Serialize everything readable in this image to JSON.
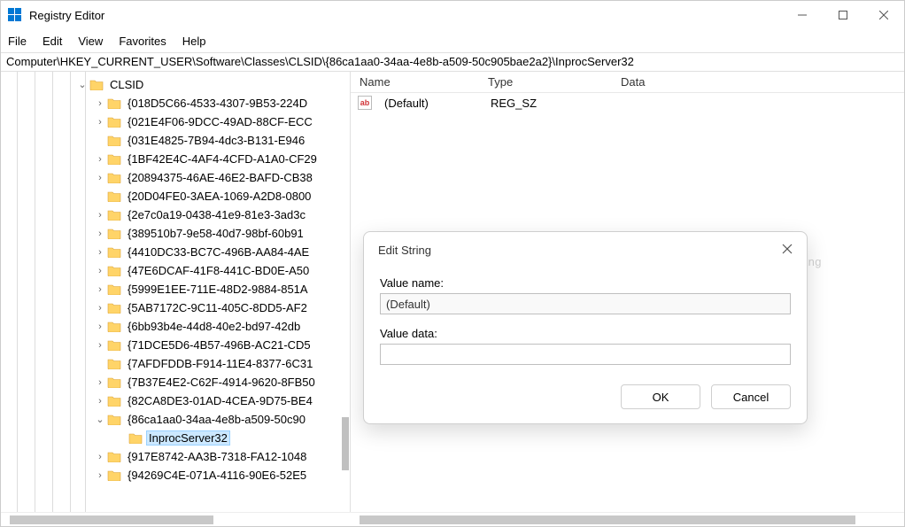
{
  "titlebar": {
    "title": "Registry Editor"
  },
  "menu": {
    "file": "File",
    "edit": "Edit",
    "view": "View",
    "favorites": "Favorites",
    "help": "Help"
  },
  "address": "Computer\\HKEY_CURRENT_USER\\Software\\Classes\\CLSID\\{86ca1aa0-34aa-4e8b-a509-50c905bae2a2}\\InprocServer32",
  "tree": {
    "parent": {
      "label": "CLSID",
      "expander": "⌄"
    },
    "items": [
      {
        "expander": "›",
        "label": "{018D5C66-4533-4307-9B53-224D"
      },
      {
        "expander": "›",
        "label": "{021E4F06-9DCC-49AD-88CF-ECC"
      },
      {
        "expander": "",
        "label": "{031E4825-7B94-4dc3-B131-E946"
      },
      {
        "expander": "›",
        "label": "{1BF42E4C-4AF4-4CFD-A1A0-CF29"
      },
      {
        "expander": "›",
        "label": "{20894375-46AE-46E2-BAFD-CB38"
      },
      {
        "expander": "",
        "label": "{20D04FE0-3AEA-1069-A2D8-0800"
      },
      {
        "expander": "›",
        "label": "{2e7c0a19-0438-41e9-81e3-3ad3c"
      },
      {
        "expander": "›",
        "label": "{389510b7-9e58-40d7-98bf-60b91"
      },
      {
        "expander": "›",
        "label": "{4410DC33-BC7C-496B-AA84-4AE"
      },
      {
        "expander": "›",
        "label": "{47E6DCAF-41F8-441C-BD0E-A50"
      },
      {
        "expander": "›",
        "label": "{5999E1EE-711E-48D2-9884-851A"
      },
      {
        "expander": "›",
        "label": "{5AB7172C-9C11-405C-8DD5-AF2"
      },
      {
        "expander": "›",
        "label": "{6bb93b4e-44d8-40e2-bd97-42db"
      },
      {
        "expander": "›",
        "label": "{71DCE5D6-4B57-496B-AC21-CD5"
      },
      {
        "expander": "",
        "label": "{7AFDFDDB-F914-11E4-8377-6C31"
      },
      {
        "expander": "›",
        "label": "{7B37E4E2-C62F-4914-9620-8FB50"
      },
      {
        "expander": "›",
        "label": "{82CA8DE3-01AD-4CEA-9D75-BE4"
      },
      {
        "expander": "⌄",
        "label": "{86ca1aa0-34aa-4e8b-a509-50c90"
      }
    ],
    "selected": {
      "label": "InprocServer32"
    },
    "after": [
      {
        "expander": "›",
        "label": "{917E8742-AA3B-7318-FA12-1048"
      },
      {
        "expander": "›",
        "label": "{94269C4E-071A-4116-90E6-52E5"
      }
    ]
  },
  "list": {
    "headers": {
      "name": "Name",
      "type": "Type",
      "data": "Data"
    },
    "row": {
      "name": "(Default)",
      "type": "REG_SZ",
      "data": ""
    }
  },
  "watermark": "uantrimang",
  "dialog": {
    "title": "Edit String",
    "value_name_label": "Value name:",
    "value_name": "(Default)",
    "value_data_label": "Value data:",
    "value_data": "",
    "ok": "OK",
    "cancel": "Cancel"
  }
}
